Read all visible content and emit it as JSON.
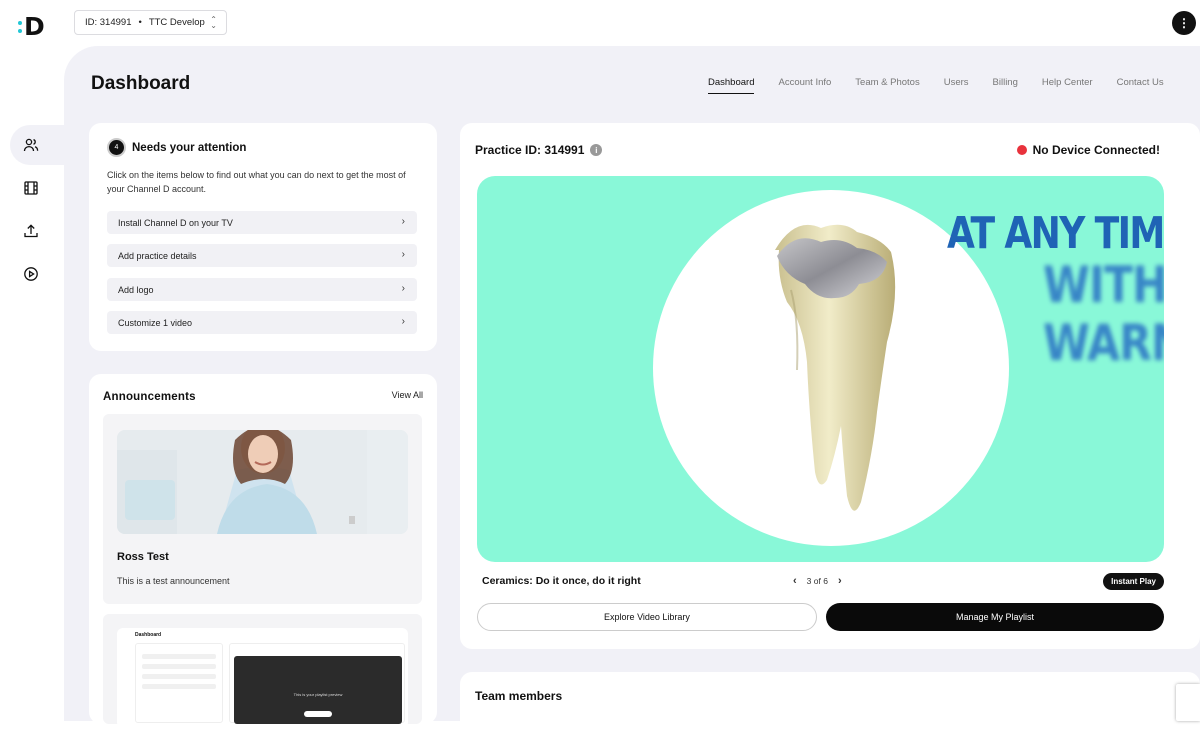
{
  "header": {
    "logo_letter": "D",
    "account_id": "ID: 314991",
    "account_separator": "•",
    "account_name": "TTC Develop",
    "menu_glyph": "⋮"
  },
  "sidebar": {
    "items": [
      {
        "icon": "users-icon",
        "active": true
      },
      {
        "icon": "film-icon",
        "active": false
      },
      {
        "icon": "upload-icon",
        "active": false
      },
      {
        "icon": "play-circle-icon",
        "active": false
      }
    ]
  },
  "page": {
    "title": "Dashboard",
    "tabs": [
      {
        "label": "Dashboard",
        "active": true
      },
      {
        "label": "Account Info"
      },
      {
        "label": "Team & Photos"
      },
      {
        "label": "Users"
      },
      {
        "label": "Billing"
      },
      {
        "label": "Help Center"
      },
      {
        "label": "Contact Us"
      }
    ]
  },
  "attention": {
    "count": "4",
    "title": "Needs your attention",
    "description": "Click on the items below to find out what you can do next to get the most of your Channel D account.",
    "tasks": [
      "Install Channel D on your TV",
      "Add practice details",
      "Add logo",
      "Customize 1 video"
    ],
    "arrow_glyph": "›"
  },
  "announcements": {
    "title": "Announcements",
    "view_all": "View All",
    "items": [
      {
        "name": "Ross Test",
        "text": "This is a test announcement"
      }
    ],
    "preview": {
      "title": "Dashboard",
      "video_text": "This is your playlist preview"
    }
  },
  "practice": {
    "id_label": "Practice ID: 314991",
    "info_glyph": "i",
    "device_status": "No Device Connected!",
    "video": {
      "line1": "AT ANY TIME",
      "line2": "WITHO",
      "line3": "WARN"
    },
    "video_name": "Ceramics: Do it once, do it right",
    "pager": {
      "prev": "‹",
      "label": "3 of 6",
      "next": "›"
    },
    "instant_play": "Instant Play",
    "explore_label": "Explore Video Library",
    "manage_label": "Manage My Playlist"
  },
  "team": {
    "title": "Team members"
  },
  "colors": {
    "accent": "#89f8d8",
    "status_red": "#e8323c",
    "logo_dots": "#22c7d6"
  }
}
